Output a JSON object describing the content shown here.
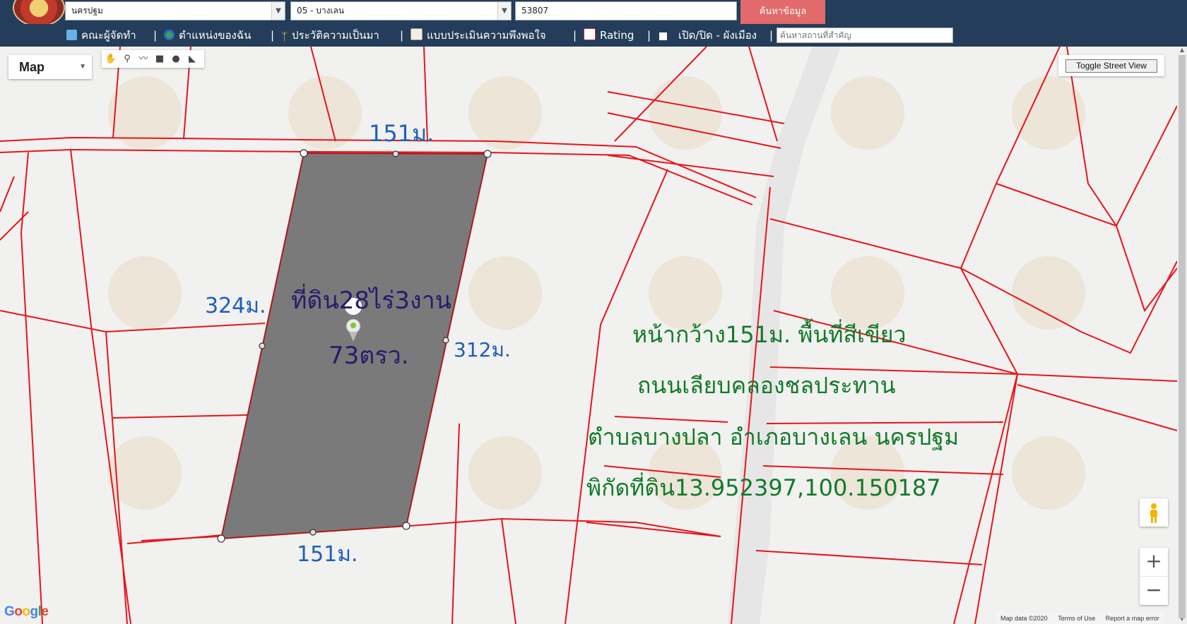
{
  "header": {
    "province_select": "นครปฐม",
    "district_select": "05 - บางเลน",
    "parcel_input": "53807",
    "search_button": "ค้นหาข้อมูล"
  },
  "nav": {
    "items": [
      {
        "label": "คณะผู้จัดทำ",
        "icon": "team-icon"
      },
      {
        "label": "ตำแหน่งของฉัน",
        "icon": "globe-icon"
      },
      {
        "label": "ประวัติความเป็นมา",
        "icon": "sprout-icon"
      },
      {
        "label": "แบบประเมินความพึงพอใจ",
        "icon": "form-icon"
      },
      {
        "label": "Rating",
        "icon": "chart-icon"
      },
      {
        "label": "เปิด/ปิด - ผังเมือง",
        "icon": "checkbox-icon"
      }
    ],
    "place_placeholder": "ค้นหาสถานที่สำคัญ"
  },
  "map_controls": {
    "map_type": "Map",
    "street_view_button": "Toggle Street View",
    "zoom_in": "+",
    "zoom_out": "−",
    "google_logo": "Google",
    "attribution": {
      "map_data": "Map data ©2020",
      "terms": "Terms of Use",
      "report": "Report a map error"
    }
  },
  "annotations": {
    "top_width": "151ม.",
    "bottom_width": "151ม.",
    "left_length": "324ม.",
    "right_length": "312ม.",
    "area_line1": "ที่ดิน28ไร่3งาน",
    "area_line2": "73ตรว.",
    "info_line1": "หน้ากว้าง151ม. พื้นที่สีเขียว",
    "info_line2": "ถนนเลียบคลองชลประทาน",
    "info_line3": "ตำบลบางปลา อำเภอบางเลน นครปฐม",
    "info_line4": "พิกัดที่ดิน13.952397,100.150187"
  },
  "colors": {
    "header_bg": "#233d5a",
    "search_btn": "#e26a6a",
    "parcel_lines": "#e8141c",
    "parcel_fill": "#7a7a7a",
    "dimension_text": "#1f5fb8",
    "area_text": "#2a1a6e",
    "info_text": "#127a2a"
  }
}
